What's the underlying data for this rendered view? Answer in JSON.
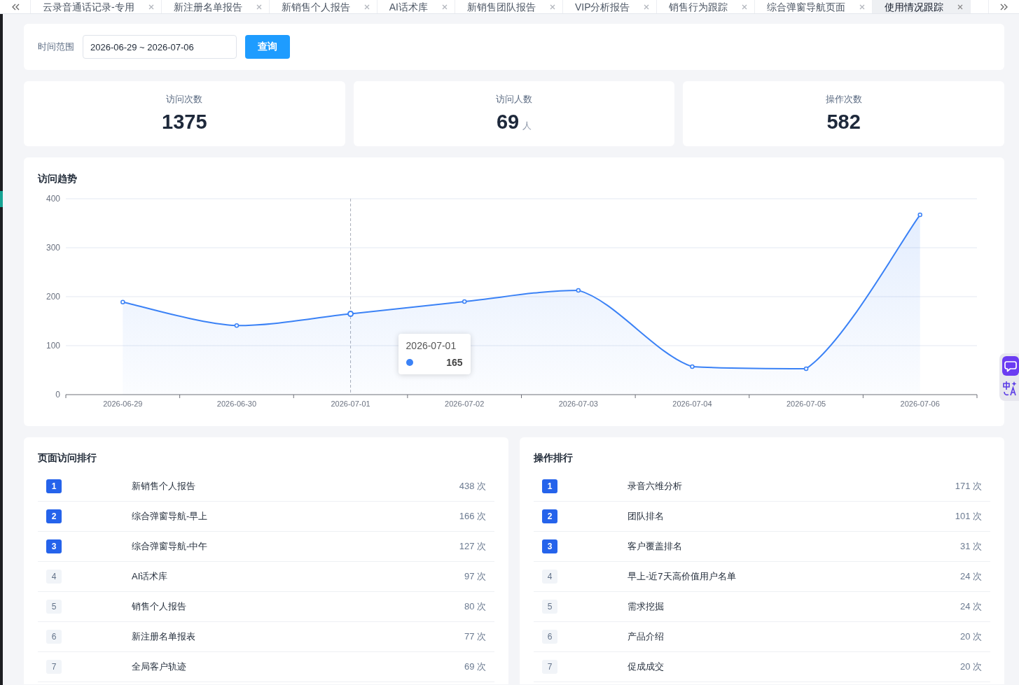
{
  "tabs": [
    {
      "label": "云录音通话记录-专用",
      "selected": false
    },
    {
      "label": "新注册名单报告",
      "selected": false
    },
    {
      "label": "新销售个人报告",
      "selected": false
    },
    {
      "label": "AI话术库",
      "selected": false
    },
    {
      "label": "新销售团队报告",
      "selected": false
    },
    {
      "label": "VIP分析报告",
      "selected": false
    },
    {
      "label": "销售行为跟踪",
      "selected": false
    },
    {
      "label": "综合弹窗导航页面",
      "selected": false
    },
    {
      "label": "使用情况跟踪",
      "selected": true
    }
  ],
  "filter": {
    "label": "时间范围",
    "date_range": "2026-06-29 ~ 2026-07-06",
    "button": "查询"
  },
  "stats": [
    {
      "label": "访问次数",
      "value": "1375"
    },
    {
      "label": "访问人数",
      "value": "69",
      "unit": "人"
    },
    {
      "label": "操作次数",
      "value": "582"
    }
  ],
  "trend": {
    "title": "访问趋势",
    "chart_data": {
      "type": "area",
      "categories": [
        "2026-06-29",
        "2026-06-30",
        "2026-07-01",
        "2026-07-02",
        "2026-07-03",
        "2026-07-04",
        "2026-07-05",
        "2026-07-06"
      ],
      "series": [
        {
          "color": "#3b82f6",
          "values": [
            189,
            141,
            165,
            190,
            213,
            57,
            53,
            367
          ]
        }
      ],
      "ylim": [
        0,
        400
      ],
      "yticks": [
        0,
        100,
        200,
        300,
        400
      ],
      "grid": true,
      "ref_lines": [
        {
          "axis": "x",
          "value": "2026-07-01",
          "color": "#a8adb8"
        }
      ]
    },
    "tooltip": {
      "date": "2026-07-01",
      "value": "165"
    }
  },
  "page_ranking": {
    "title": "页面访问排行",
    "rows": [
      {
        "rank": "1",
        "name": "新销售个人报告",
        "count": "438 次",
        "highlighted": true
      },
      {
        "rank": "2",
        "name": "综合弹窗导航-早上",
        "count": "166 次",
        "highlighted": true
      },
      {
        "rank": "3",
        "name": "综合弹窗导航-中午",
        "count": "127 次",
        "highlighted": true
      },
      {
        "rank": "4",
        "name": "AI话术库",
        "count": "97 次",
        "highlighted": false
      },
      {
        "rank": "5",
        "name": "销售个人报告",
        "count": "80 次",
        "highlighted": false
      },
      {
        "rank": "6",
        "name": "新注册名单报表",
        "count": "77 次",
        "highlighted": false
      },
      {
        "rank": "7",
        "name": "全局客户轨迹",
        "count": "69 次",
        "highlighted": false
      }
    ]
  },
  "action_ranking": {
    "title": "操作排行",
    "rows": [
      {
        "rank": "1",
        "name": "录音六维分析",
        "count": "171 次",
        "highlighted": true
      },
      {
        "rank": "2",
        "name": "团队排名",
        "count": "101 次",
        "highlighted": true
      },
      {
        "rank": "3",
        "name": "客户覆盖排名",
        "count": "31 次",
        "highlighted": true
      },
      {
        "rank": "4",
        "name": "早上-近7天高价值用户名单",
        "count": "24 次",
        "highlighted": false
      },
      {
        "rank": "5",
        "name": "需求挖掘",
        "count": "24 次",
        "highlighted": false
      },
      {
        "rank": "6",
        "name": "产品介绍",
        "count": "20 次",
        "highlighted": false
      },
      {
        "rank": "7",
        "name": "促成成交",
        "count": "20 次",
        "highlighted": false
      }
    ]
  }
}
